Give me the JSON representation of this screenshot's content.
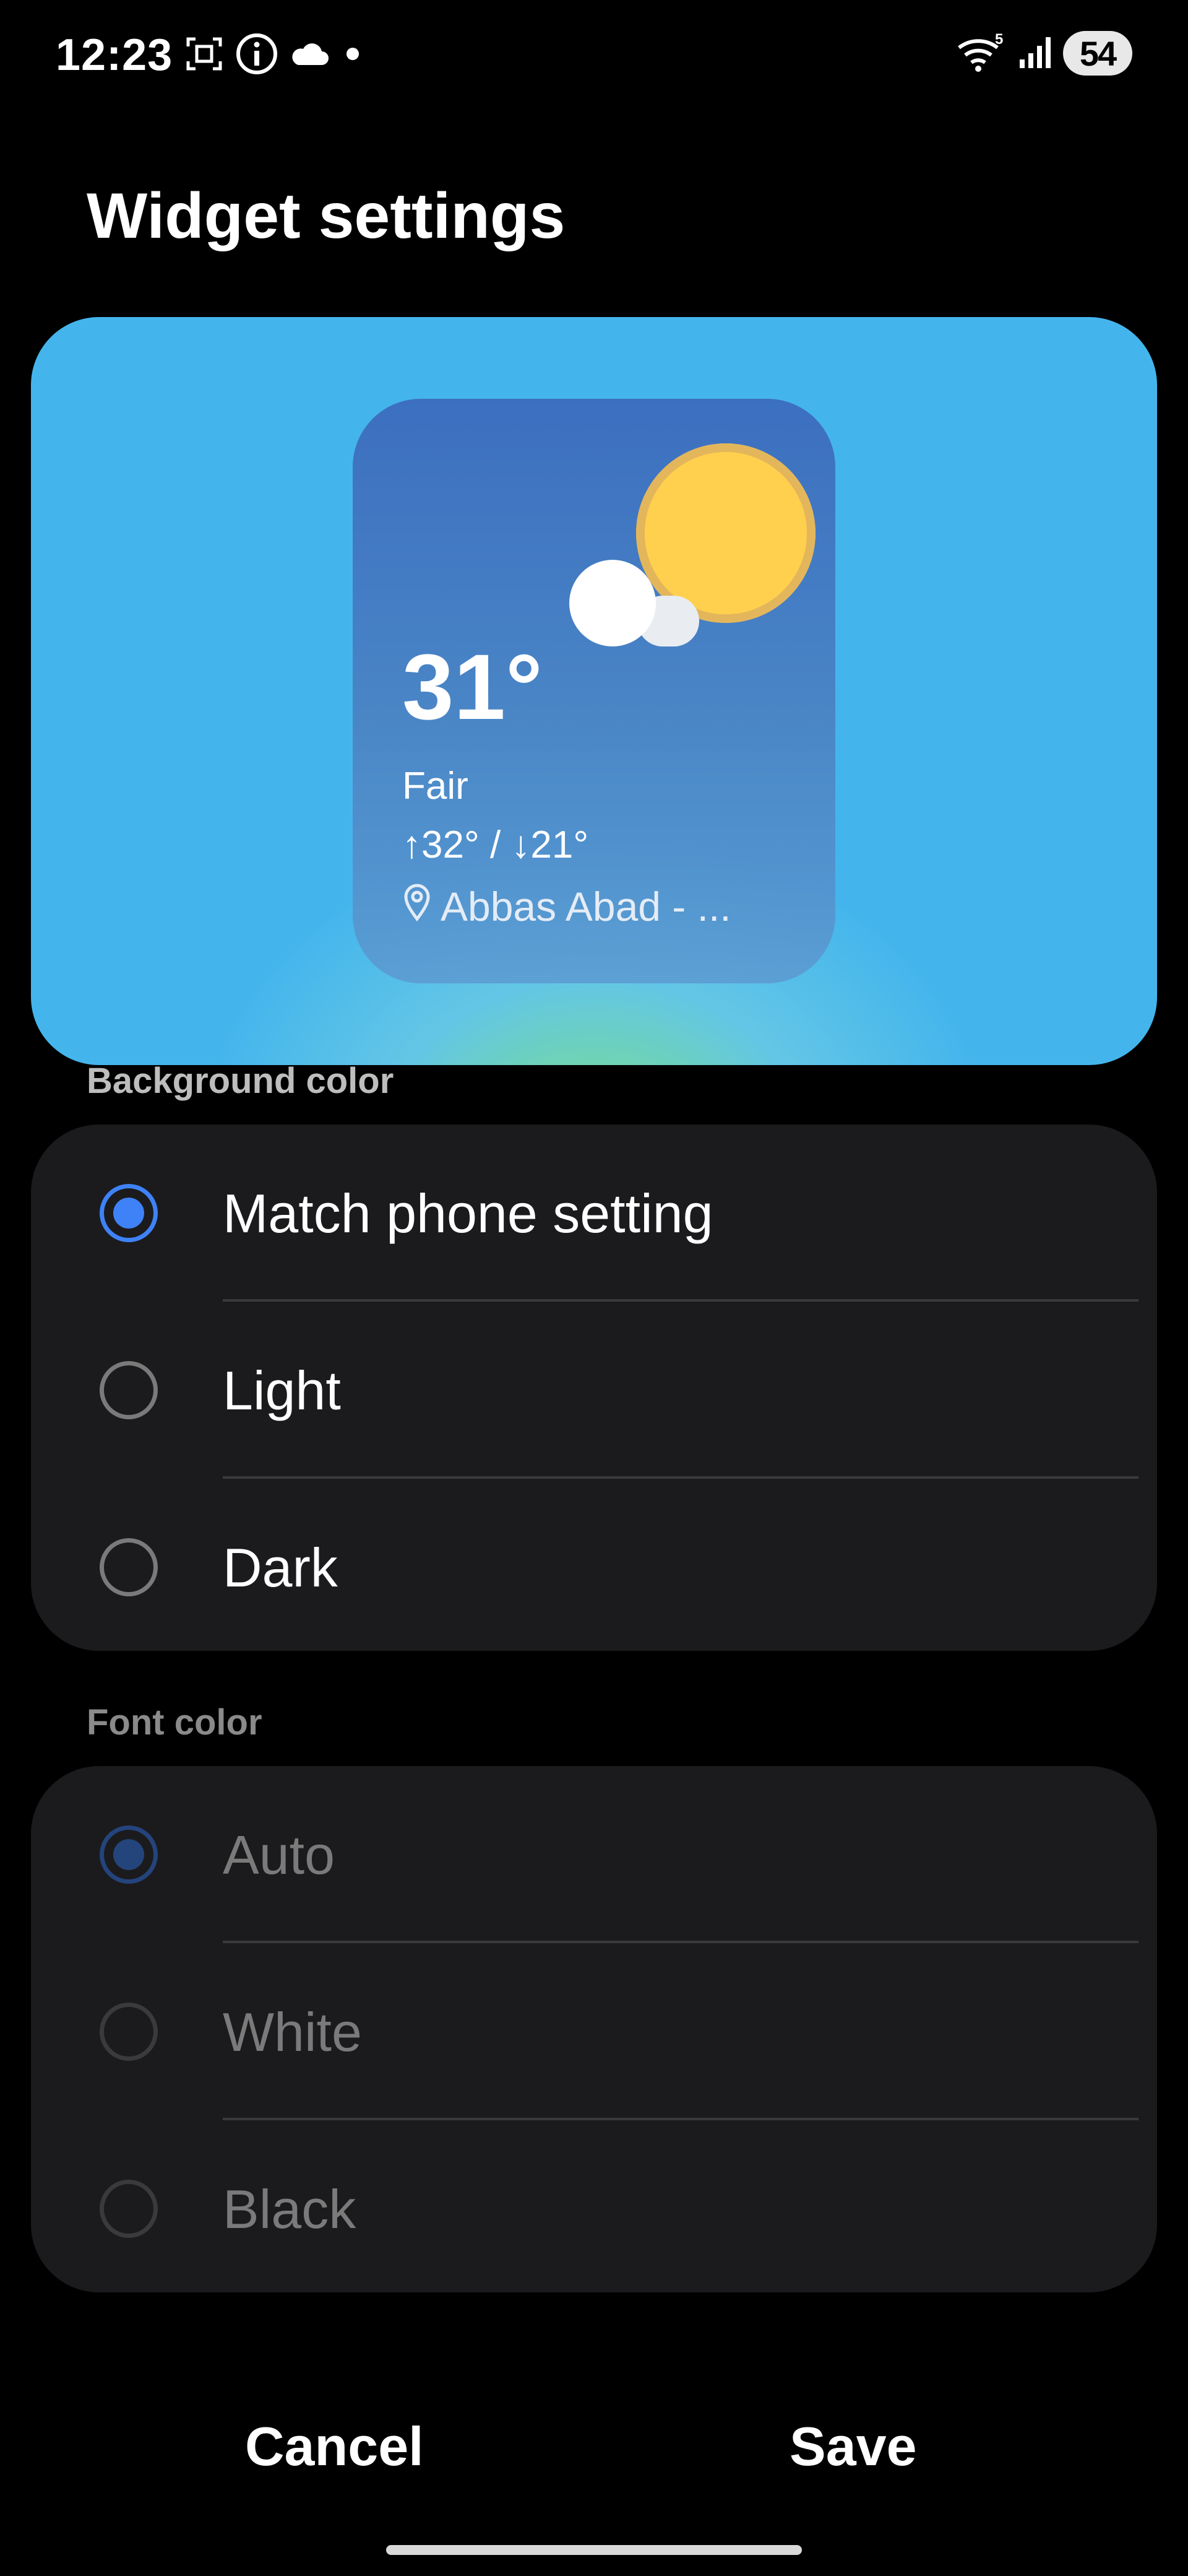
{
  "status_bar": {
    "time": "12:23",
    "network_badge": "5",
    "battery_level": "54"
  },
  "title": "Widget settings",
  "widget_preview": {
    "temperature": "31°",
    "condition": "Fair",
    "high_low": "↑32° / ↓21°",
    "location": "Abbas Abad - ..."
  },
  "background_color": {
    "label": "Background color",
    "options": [
      {
        "label": "Match phone setting",
        "selected": true
      },
      {
        "label": "Light",
        "selected": false
      },
      {
        "label": "Dark",
        "selected": false
      }
    ]
  },
  "font_color": {
    "label": "Font color",
    "enabled": false,
    "options": [
      {
        "label": "Auto",
        "selected": true
      },
      {
        "label": "White",
        "selected": false
      },
      {
        "label": "Black",
        "selected": false
      }
    ]
  },
  "buttons": {
    "cancel": "Cancel",
    "save": "Save"
  },
  "colors": {
    "accent": "#3f82f7",
    "preview_background": "#44b5ec",
    "card_background": "#1b1b1d",
    "widget_background": "#3c6fc0"
  },
  "icons": {
    "status_left": [
      "screenshot-icon",
      "info-icon",
      "cloud-icon",
      "notification-dot-icon"
    ],
    "status_right": [
      "wifi-icon",
      "signal-icon",
      "battery-icon"
    ],
    "widget": [
      "sun-icon",
      "cloud-icon",
      "location-pin-icon"
    ]
  }
}
